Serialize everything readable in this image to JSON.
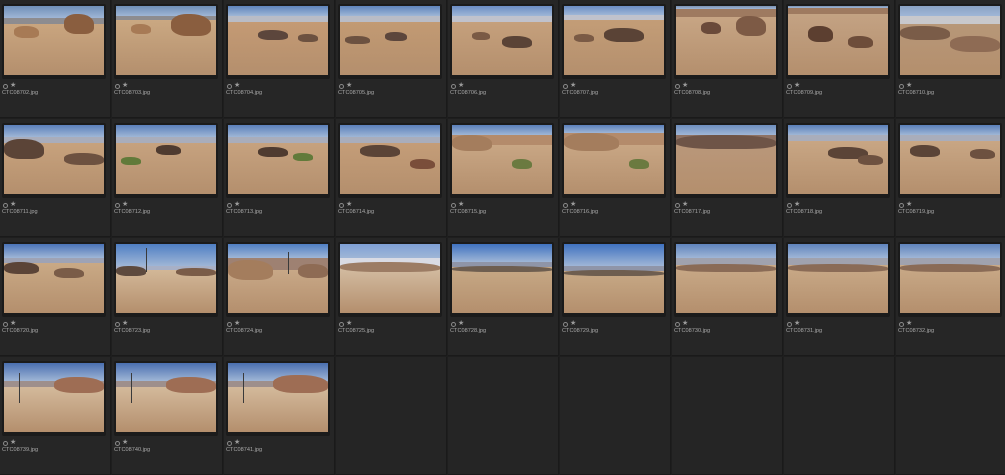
{
  "browser": {
    "rows": [
      [
        "CTC08702.jpg",
        "CTC08703.jpg",
        "CTC08704.jpg",
        "CTC08705.jpg",
        "CTC08706.jpg",
        "CTC08707.jpg",
        "CTC08708.jpg",
        "CTC08709.jpg",
        "CTC08710.jpg"
      ],
      [
        "CTC08711.jpg",
        "CTC08712.jpg",
        "CTC08713.jpg",
        "CTC08714.jpg",
        "CTC08715.jpg",
        "CTC08716.jpg",
        "CTC08717.jpg",
        "CTC08718.jpg",
        "CTC08719.jpg"
      ],
      [
        "CTC08720.jpg",
        "CTC08723.jpg",
        "CTC08724.jpg",
        "CTC08725.jpg",
        "CTC08728.jpg",
        "CTC08729.jpg",
        "CTC08730.jpg",
        "CTC08731.jpg",
        "CTC08732.jpg"
      ],
      [
        "CTC08739.jpg",
        "CTC08740.jpg",
        "CTC08741.jpg"
      ]
    ],
    "rating_icons": {
      "label": "label-circle-icon",
      "star": "star-icon",
      "star_glyph": "★"
    }
  }
}
